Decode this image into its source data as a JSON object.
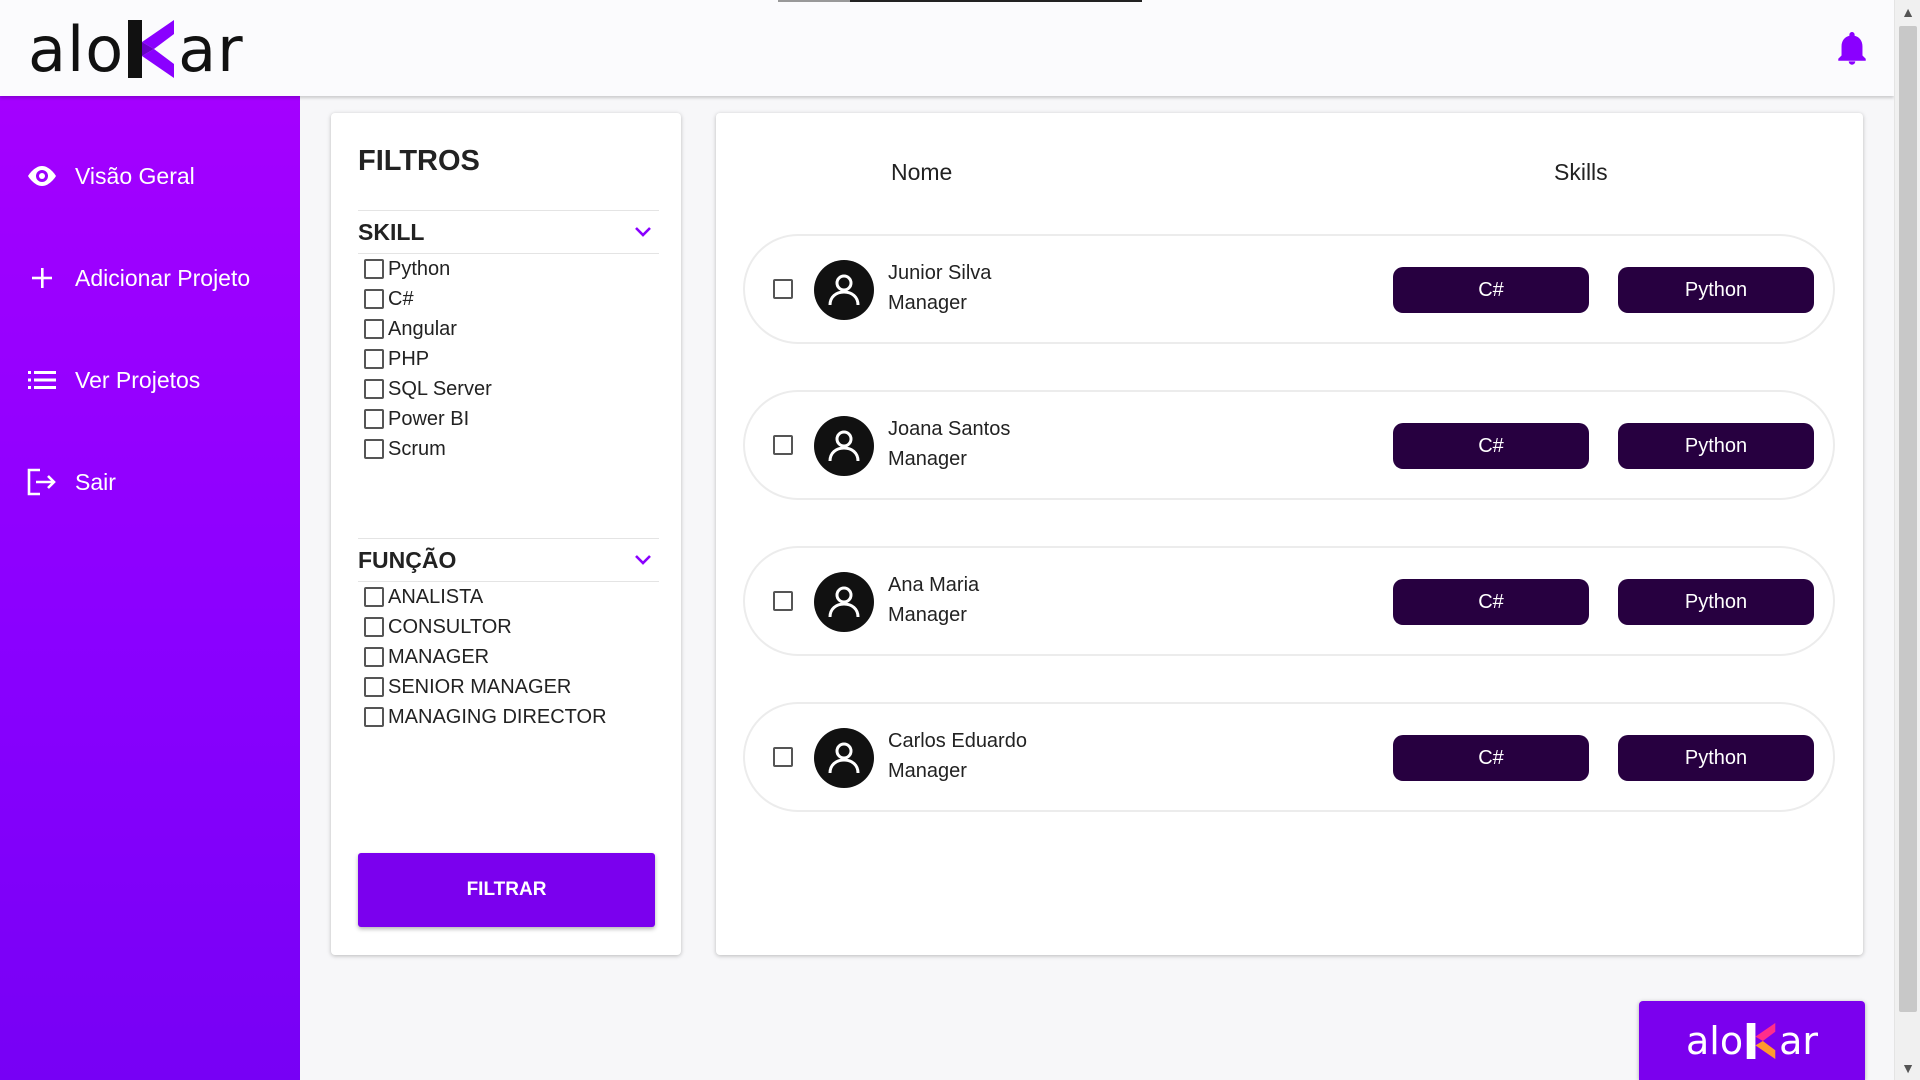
{
  "header": {
    "logo_left": "alo",
    "logo_right": "ar",
    "icons": {
      "notifications": "bell-icon"
    },
    "accent_color": "#8a00ff"
  },
  "sidebar": {
    "items": [
      {
        "label": "Visão Geral",
        "icon": "eye-icon"
      },
      {
        "label": "Adicionar Projeto",
        "icon": "plus-icon"
      },
      {
        "label": "Ver Projetos",
        "icon": "list-icon"
      },
      {
        "label": "Sair",
        "icon": "logout-icon"
      }
    ]
  },
  "filters": {
    "title": "FILTROS",
    "skill": {
      "label": "SKILL",
      "options": [
        "Python",
        "C#",
        "Angular",
        "PHP",
        "SQL Server",
        "Power BI",
        "Scrum"
      ]
    },
    "funcao": {
      "label": "FUNÇÃO",
      "options": [
        "ANALISTA",
        "CONSULTOR",
        "MANAGER",
        "SENIOR MANAGER",
        "MANAGING DIRECTOR"
      ]
    },
    "submit_label": "FILTRAR"
  },
  "results": {
    "columns": {
      "name": "Nome",
      "skills": "Skills"
    },
    "people": [
      {
        "name": "Junior Silva",
        "role": "Manager",
        "skills": [
          "C#",
          "Python"
        ]
      },
      {
        "name": "Joana Santos",
        "role": "Manager",
        "skills": [
          "C#",
          "Python"
        ]
      },
      {
        "name": "Ana Maria",
        "role": "Manager",
        "skills": [
          "C#",
          "Python"
        ]
      },
      {
        "name": "Carlos Eduardo",
        "role": "Manager",
        "skills": [
          "C#",
          "Python"
        ]
      }
    ]
  },
  "brand_button": {
    "left": "alo",
    "right": "ar"
  }
}
